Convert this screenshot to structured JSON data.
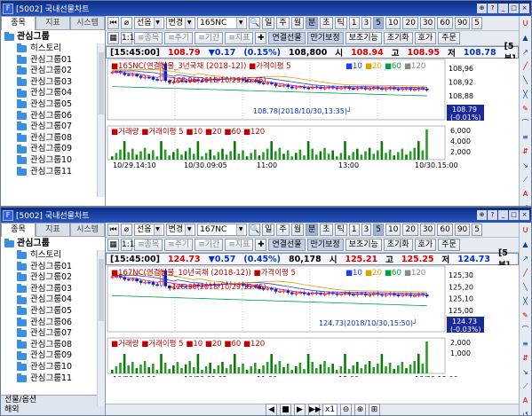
{
  "left": {
    "tabs": [
      "종목",
      "지표",
      "시스템"
    ],
    "group": "관심그룹",
    "items": [
      "히스토리",
      "관심그룹01",
      "관심그룹02",
      "관심그룹03",
      "관심그룹04",
      "관심그룹05",
      "관심그룹06",
      "관심그룹07",
      "관심그룹08",
      "관심그룹09",
      "관심그룹10",
      "관심그룹11"
    ]
  },
  "windows": [
    {
      "title": "[5002] 국내선물차트",
      "type": "선옵",
      "change": "변경",
      "code": "165NC",
      "periods": [
        "일",
        "주",
        "월",
        "분",
        "초",
        "틱",
        "1",
        "3",
        "5",
        "10",
        "20",
        "30",
        "60",
        "90",
        "5"
      ],
      "tools": [
        "종목",
        "주기",
        "기간",
        "지표"
      ],
      "tools2": [
        "연결선물",
        "만기보정",
        "보조기능",
        "초기화",
        "호가",
        "주문"
      ],
      "quote": {
        "time": "[15:45:00]",
        "price": "108.79",
        "change": "▼0.17",
        "pct": "(0.15%)",
        "vol": "108,800",
        "open_l": "시",
        "open": "108.94",
        "high_l": "고",
        "high": "108.95",
        "low_l": "저",
        "low": "108.78",
        "unit": "[5분]"
      },
      "legend": "165NC(연결선물_3년국채 (2018-12))",
      "ma": "가격이평 5",
      "ma2": [
        "10",
        "20",
        "60",
        "120"
      ],
      "ann_high": "108.96(2018/10/29,15:45)",
      "ann_low": "108.78(2018/10/30,13:35)",
      "price_ticks": [
        "108,96",
        "108,92",
        "108,88",
        "108,84"
      ],
      "last_label": "108.79",
      "last_pct": "-0.01%",
      "vol_legend": "거래량",
      "vol_ma": "거래이평 5",
      "vol_ticks": [
        "6,000",
        "4,000",
        "2,000"
      ],
      "xticks": [
        "10/29,14:10",
        "10/30,09:05",
        "11:00",
        "13:00",
        "10/30,15:00"
      ]
    },
    {
      "title": "[5002] 국내선물차트",
      "type": "선옵",
      "change": "변경",
      "code": "167NC",
      "periods": [
        "일",
        "주",
        "월",
        "분",
        "초",
        "틱",
        "1",
        "3",
        "5",
        "10",
        "20",
        "30",
        "60",
        "90",
        "5"
      ],
      "tools": [
        "종목",
        "주기",
        "기간",
        "지표"
      ],
      "tools2": [
        "연결선물",
        "만기보정",
        "보조기능",
        "초기화",
        "호가",
        "주문"
      ],
      "quote": {
        "time": "[15:45:00]",
        "price": "124.73",
        "change": "▼0.57",
        "pct": "(0.45%)",
        "vol": "80,178",
        "open_l": "시",
        "open": "125.21",
        "high_l": "고",
        "high": "125.25",
        "low_l": "저",
        "low": "124.73",
        "unit": "[5분]"
      },
      "legend": "167NC(연결선물_10년국채 (2018-12))",
      "ma": "가격이평 5",
      "ma2": [
        "10",
        "20",
        "60",
        "120"
      ],
      "ann_high": "125.30(2018/10/29,15:45)",
      "ann_low": "124.73(2018/10/30,15:50)",
      "price_ticks": [
        "125,30",
        "125,20",
        "125,10",
        "125,00",
        "124,90"
      ],
      "last_label": "124.73",
      "last_pct": "-0.03%",
      "vol_legend": "거래량",
      "vol_ma": "거래이평 5",
      "vol_ticks": [
        "2,000",
        "1,000"
      ],
      "xticks": [
        "10/29,14:10",
        "10/30,09:05",
        "11:00",
        "13:00",
        "10/30,15:00"
      ],
      "left_bottom": [
        "선물/옵션",
        "해외"
      ],
      "zoom": "x1"
    }
  ]
}
